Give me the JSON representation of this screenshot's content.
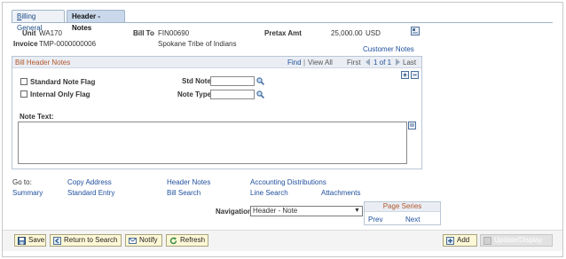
{
  "tabs": [
    {
      "prefix": "B",
      "rest": "illing General"
    },
    {
      "label": "Header - Notes"
    }
  ],
  "header": {
    "unit_label": "Unit",
    "unit_value": "WA170",
    "bill_to_label": "Bill To",
    "bill_to_value": "FIN00690",
    "pretax_label": "Pretax Amt",
    "pretax_value": "25,000.00",
    "currency": "USD",
    "invoice_label": "Invoice",
    "invoice_value": "TMP-0000000006",
    "customer_name": "Spokane Tribe of Indians",
    "customer_notes_link": "Customer Notes"
  },
  "notes": {
    "title": "Bill Header Notes",
    "find": "Find",
    "sep": "|",
    "view_all": "View All",
    "first": "First",
    "range": "1 of 1",
    "last": "Last",
    "standard_note_flag": "Standard Note Flag",
    "internal_only_flag": "Internal Only Flag",
    "std_note_label": "Std Note",
    "note_type_label": "Note Type",
    "note_text_label": "Note Text:",
    "add_row": "+",
    "delete_row": "−"
  },
  "links": {
    "go_to": "Go to:",
    "copy_address": "Copy Address",
    "header_notes": "Header Notes",
    "accounting_distributions": "Accounting Distributions",
    "summary": "Summary",
    "standard_entry": "Standard Entry",
    "bill_search": "Bill Search",
    "line_search": "Line Search",
    "attachments": "Attachments"
  },
  "navigation": {
    "label": "Navigation",
    "selected": "Header - Note",
    "series_title": "Page Series",
    "prev": "Prev",
    "next": "Next"
  },
  "toolbar": {
    "save": "Save",
    "return_to_search": "Return to Search",
    "notify": "Notify",
    "refresh": "Refresh",
    "add": "Add",
    "update_display": "Update/Display"
  }
}
